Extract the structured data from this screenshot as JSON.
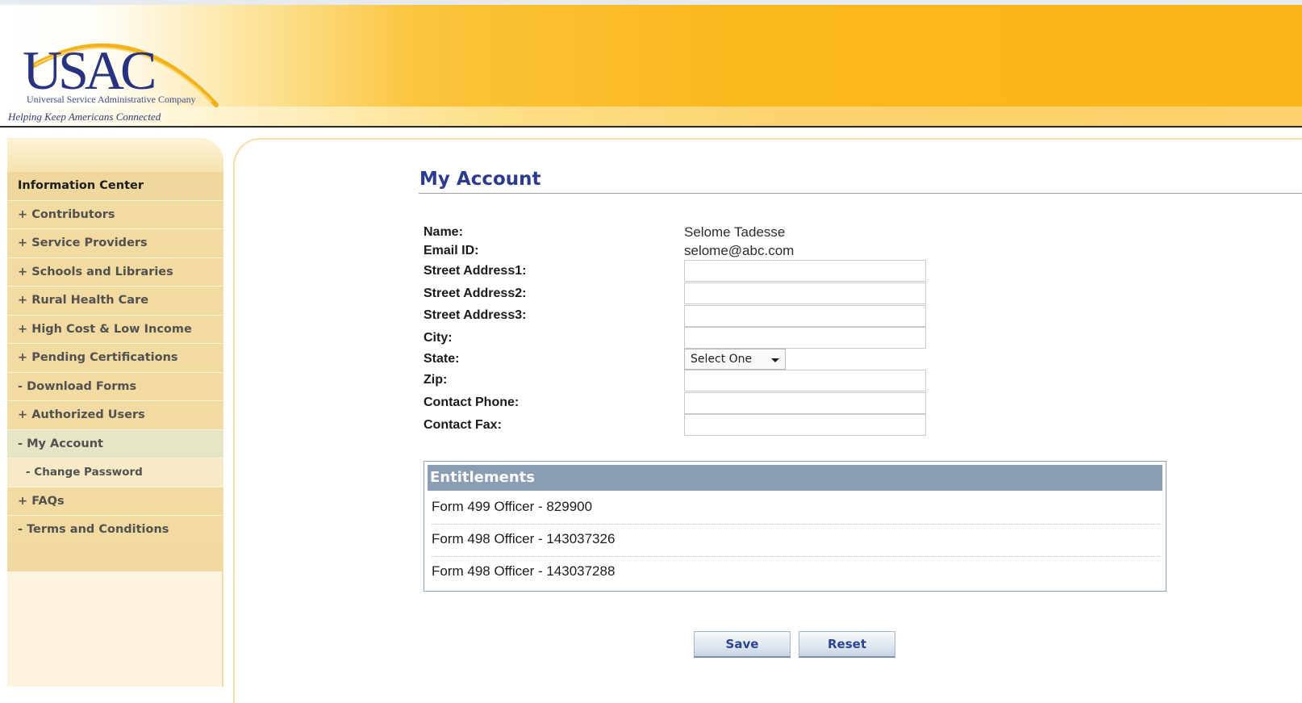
{
  "brand": {
    "logo_text": "USAC",
    "company_name": "Universal Service Administrative Company",
    "tagline": "Helping Keep Americans Connected",
    "colors": {
      "header_orange": "#fbb81d",
      "navy": "#27337e",
      "sidebar_tan": "#f1dba3",
      "title_blue": "#2c3b8d",
      "entitlement_header": "#8a9db5"
    }
  },
  "sidebar": {
    "items": [
      {
        "label": "Information Center",
        "type": "heading"
      },
      {
        "label": "+ Contributors"
      },
      {
        "label": "+ Service Providers"
      },
      {
        "label": "+ Schools and Libraries"
      },
      {
        "label": "+ Rural Health Care"
      },
      {
        "label": "+ High Cost & Low Income"
      },
      {
        "label": "+ Pending Certifications"
      },
      {
        "label": "- Download Forms"
      },
      {
        "label": "+ Authorized Users"
      },
      {
        "label": "- My Account",
        "active": true
      },
      {
        "label": "- Change Password",
        "type": "sub"
      },
      {
        "label": "+ FAQs"
      },
      {
        "label": "- Terms and Conditions"
      }
    ]
  },
  "main": {
    "title": "My Account",
    "fields": {
      "name": {
        "label": "Name:",
        "value": "Selome Tadesse"
      },
      "email": {
        "label": "Email ID:",
        "value": "selome@abc.com"
      },
      "street1": {
        "label": "Street Address1:",
        "value": ""
      },
      "street2": {
        "label": "Street Address2:",
        "value": ""
      },
      "street3": {
        "label": "Street Address3:",
        "value": ""
      },
      "city": {
        "label": "City:",
        "value": ""
      },
      "state": {
        "label": "State:",
        "selected": "Select One"
      },
      "zip": {
        "label": "Zip:",
        "value": ""
      },
      "phone": {
        "label": "Contact Phone:",
        "value": ""
      },
      "fax": {
        "label": "Contact Fax:",
        "value": ""
      }
    },
    "entitlements": {
      "header": "Entitlements",
      "rows": [
        "Form 499 Officer - 829900",
        "Form 498 Officer - 143037326",
        "Form 498 Officer - 143037288"
      ]
    },
    "buttons": {
      "save": "Save",
      "reset": "Reset"
    }
  },
  "icons": {
    "state_dropdown": "chevron-down-icon"
  }
}
